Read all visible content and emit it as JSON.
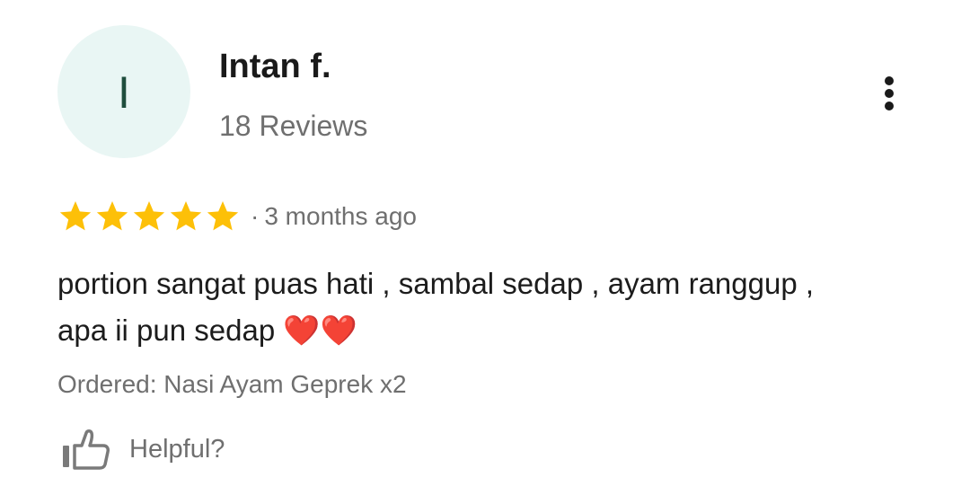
{
  "reviewer": {
    "initial": "I",
    "name": "Intan f.",
    "review_count": "18 Reviews",
    "avatar_bg": "#e9f6f4",
    "avatar_fg": "#1f4e3d"
  },
  "rating": {
    "stars": 5,
    "max_stars": 5,
    "star_color": "#fdc008",
    "separator": "·",
    "date": "3 months ago"
  },
  "review": {
    "line1": "portion sangat puas hati , sambal sedap , ayam ranggup ,",
    "line2": "apa ii pun sedap ❤️❤️"
  },
  "ordered": "Ordered: Nasi Ayam Geprek x2",
  "actions": {
    "helpful_label": "Helpful?",
    "helpful_icon": "thumbs-up-icon",
    "more_icon": "more-vertical-icon"
  }
}
